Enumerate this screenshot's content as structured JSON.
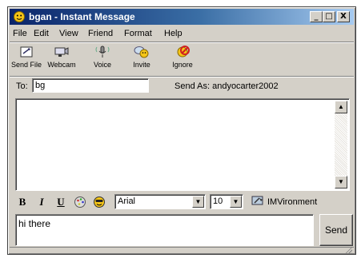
{
  "window": {
    "title": "bgan - Instant Message"
  },
  "title_buttons": {
    "minimize": "_",
    "maximize": "□",
    "close": "X"
  },
  "menu": [
    "File",
    "Edit",
    "View",
    "Friend",
    "Format",
    "Help"
  ],
  "toolbar": [
    {
      "label": "Send File",
      "icon": "send-file-icon"
    },
    {
      "label": "Webcam",
      "icon": "webcam-icon"
    },
    {
      "label": "Voice",
      "icon": "microphone-icon"
    },
    {
      "label": "Invite",
      "icon": "invite-icon"
    },
    {
      "label": "Ignore",
      "icon": "ignore-icon"
    }
  ],
  "to": {
    "label": "To:",
    "value": "bg"
  },
  "send_as": "Send As:  andyocarter2002",
  "format": {
    "bold": "B",
    "italic": "I",
    "underline": "U",
    "font": "Arial",
    "size": "10",
    "imvironment": "IMVironment"
  },
  "compose": {
    "value": "hi there"
  },
  "send_button": "Send",
  "colors": {
    "title_start": "#0a246a",
    "title_end": "#a6caf0",
    "face": "#d4d0c8"
  }
}
